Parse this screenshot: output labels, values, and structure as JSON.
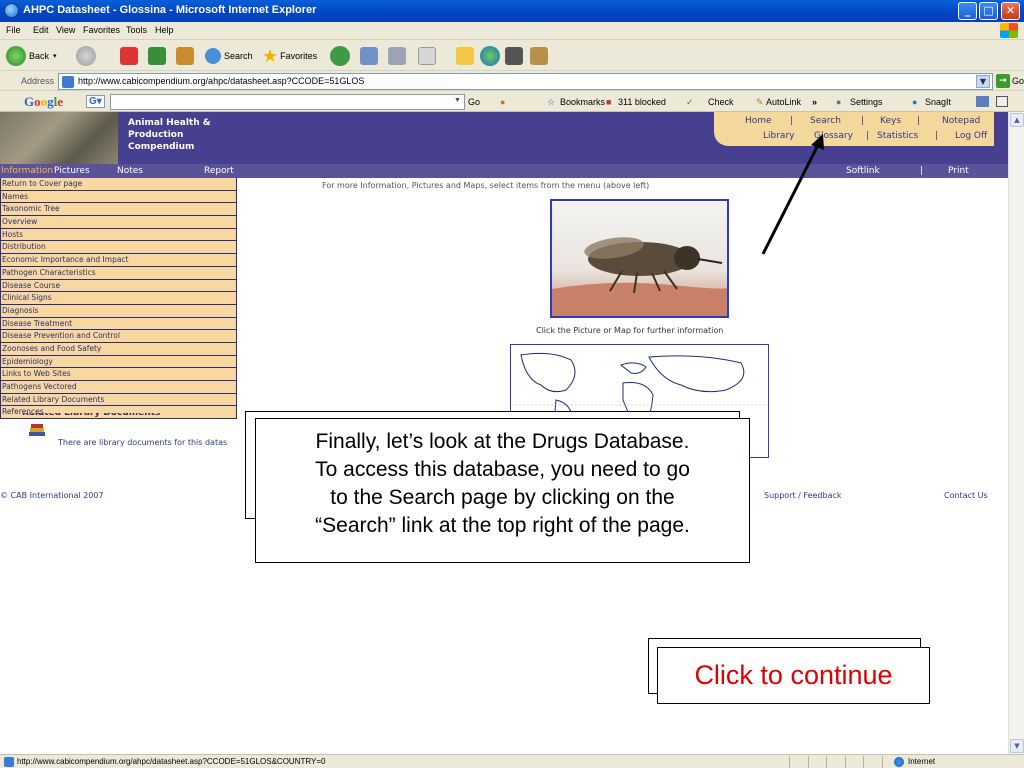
{
  "window": {
    "title": "AHPC Datasheet - Glossina - Microsoft Internet Explorer"
  },
  "menu": [
    "File",
    "Edit",
    "View",
    "Favorites",
    "Tools",
    "Help"
  ],
  "toolbar": {
    "back": "Back",
    "search": "Search",
    "favorites": "Favorites"
  },
  "address": {
    "label": "Address",
    "url": "http://www.cabicompendium.org/ahpc/datasheet.asp?CCODE=51GLOS",
    "go": "Go"
  },
  "google_bar": {
    "logo": "Google",
    "go": "Go",
    "bookmarks": "Bookmarks",
    "blocked": "311 blocked",
    "check": "Check",
    "autolink": "AutoLink",
    "settings": "Settings",
    "snagit": "SnagIt"
  },
  "site": {
    "brand": [
      "Animal Health &",
      "Production",
      "Compendium"
    ],
    "nav": {
      "home": "Home",
      "search": "Search",
      "keys": "Keys",
      "notepad": "Notepad",
      "library": "Library",
      "glossary": "Glossary",
      "statistics": "Statistics",
      "logoff": "Log Off"
    },
    "tabs": {
      "information": "Information",
      "pictures": "Pictures",
      "notes": "Notes",
      "report": "Report",
      "softlink": "Softlink",
      "print": "Print"
    },
    "menu_items": [
      "Return to Cover page",
      "Names",
      "Taxonomic Tree",
      "Overview",
      "Hosts",
      "Distribution",
      "Economic Importance and Impact",
      "Pathogen Characteristics",
      "Disease Course",
      "Clinical Signs",
      "Diagnosis",
      "Disease Treatment",
      "Disease Prevention and Control",
      "Zoonoses and Food Safety",
      "Epidemiology",
      "Links to Web Sites",
      "Pathogens Vectored",
      "Related Library Documents",
      "References"
    ],
    "info_text": "For more Information, Pictures and Maps, select items from the menu (above left)",
    "click_picture": "Click the Picture or Map for further information",
    "related_heading": "Related Library Documents",
    "library_text": "There are library documents for this datas",
    "copyright": "© CAB International 2007",
    "support": "Support / Feedback",
    "contact": "Contact Us"
  },
  "callout": {
    "lines": [
      "Finally, let’s look at the Drugs Database.",
      "To access this database, you need to go",
      "to the Search page by clicking on the",
      "“Search” link at the top right of the page."
    ]
  },
  "continue_label": "Click to continue",
  "status": {
    "url": "http://www.cabicompendium.org/ahpc/datasheet.asp?CCODE=51GLOS&COUNTRY=0",
    "zone": "Internet"
  },
  "colors": {
    "site_purple": "#473f8f",
    "menu_peach": "#f8d8a0",
    "continue_red": "#e00000"
  }
}
